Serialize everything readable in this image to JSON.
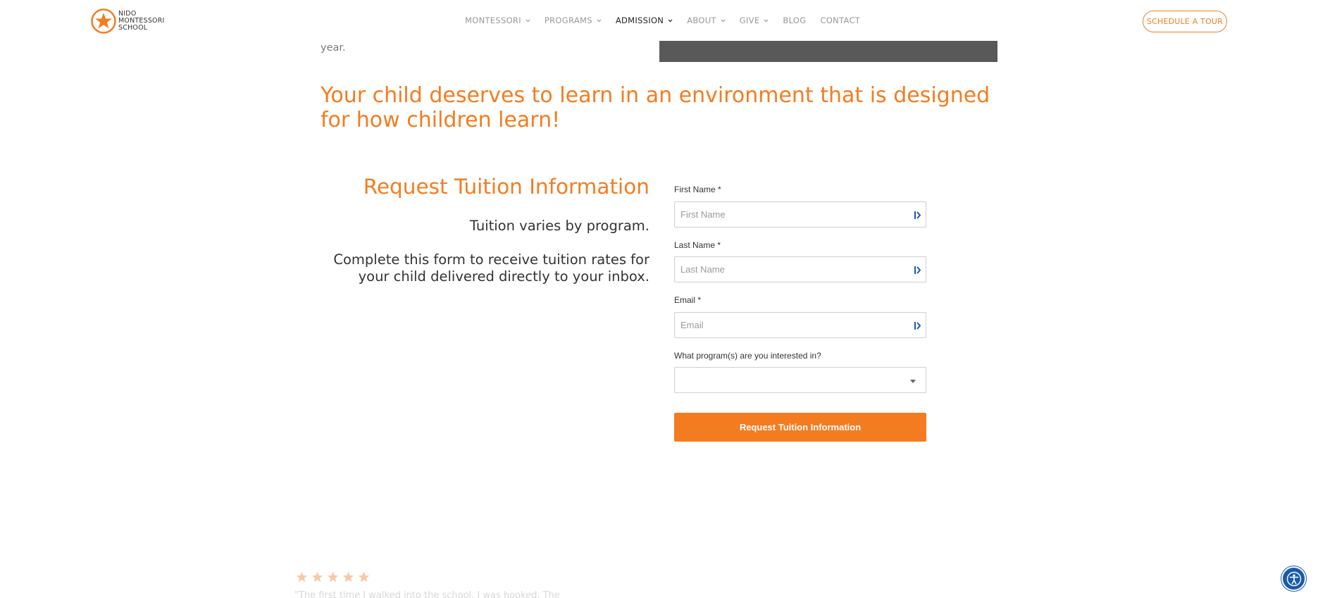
{
  "header": {
    "logo": {
      "lines": [
        "NIDO",
        "MONTESSORI",
        "SCHOOL"
      ],
      "icon": "star-circle-logo"
    },
    "nav": [
      {
        "label": "MONTESSORI",
        "has_dropdown": true,
        "active": false
      },
      {
        "label": "PROGRAMS",
        "has_dropdown": true,
        "active": false
      },
      {
        "label": "ADMISSION",
        "has_dropdown": true,
        "active": true
      },
      {
        "label": "ABOUT",
        "has_dropdown": true,
        "active": false
      },
      {
        "label": "GIVE",
        "has_dropdown": true,
        "active": false
      },
      {
        "label": "BLOG",
        "has_dropdown": false,
        "active": false
      },
      {
        "label": "CONTACT",
        "has_dropdown": false,
        "active": false
      }
    ],
    "cta_label": "SCHEDULE A TOUR"
  },
  "intro": {
    "partial_text": "year."
  },
  "headline": "Your child deserves to learn in an environment that is designed for how children learn!",
  "tuition": {
    "title": "Request Tuition Information",
    "subtitle": "Tuition varies by program.",
    "description": "Complete this form to receive tuition rates for your child delivered directly to your inbox."
  },
  "form": {
    "first_name": {
      "label": "First Name *",
      "placeholder": "First Name"
    },
    "last_name": {
      "label": "Last Name *",
      "placeholder": "Last Name"
    },
    "email": {
      "label": "Email *",
      "placeholder": "Email"
    },
    "program": {
      "label": "What program(s) are you interested in?",
      "value": ""
    },
    "submit_label": "Request Tuition Information"
  },
  "testimonial": {
    "stars": 5,
    "text": "\"The first time I walked into the school, I was hooked. The"
  },
  "colors": {
    "accent": "#f47c20",
    "dark_block": "#595959",
    "accessibility": "#1a5aa8"
  },
  "icons": {
    "nav_dropdown": "chevron-down-icon",
    "autofill": "autofill-key-icon",
    "select_caret": "caret-down-icon",
    "rating": "star-icon",
    "accessibility": "accessibility-icon"
  }
}
